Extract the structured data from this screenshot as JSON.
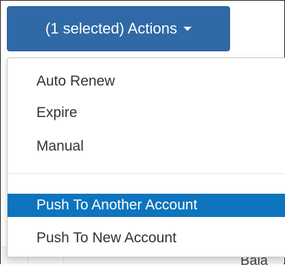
{
  "actions_button": {
    "label": "(1 selected) Actions"
  },
  "menu": {
    "items": [
      {
        "label": "Auto Renew"
      },
      {
        "label": "Expire"
      },
      {
        "label": "Manual"
      },
      {
        "label": "Push To Another Account",
        "active": true
      },
      {
        "label": "Push To New Account"
      }
    ]
  },
  "background": {
    "partial_text": "Bala"
  },
  "colors": {
    "button_bg": "#2f6aa6",
    "active_item_bg": "#0d74bd",
    "text": "#333333"
  }
}
